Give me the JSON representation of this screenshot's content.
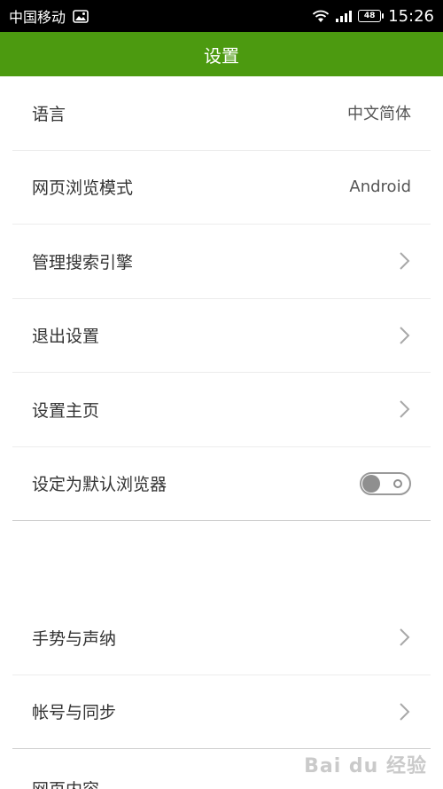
{
  "status_bar": {
    "carrier": "中国移动",
    "battery": "48",
    "time": "15:26"
  },
  "header": {
    "title": "设置"
  },
  "settings_group_1": [
    {
      "label": "语言",
      "value": "中文简体",
      "control": "value"
    },
    {
      "label": "网页浏览模式",
      "value": "Android",
      "control": "value"
    },
    {
      "label": "管理搜索引擎",
      "control": "chevron"
    },
    {
      "label": "退出设置",
      "control": "chevron"
    },
    {
      "label": "设置主页",
      "control": "chevron"
    },
    {
      "label": "设定为默认浏览器",
      "control": "toggle",
      "toggle_on": false
    }
  ],
  "settings_group_2": [
    {
      "label": "手势与声纳",
      "control": "chevron"
    },
    {
      "label": "帐号与同步",
      "control": "chevron"
    }
  ],
  "partial_item": {
    "label": "网页内容"
  },
  "watermark": {
    "text": "Bai du 经验"
  },
  "colors": {
    "header_green": "#4c9a10",
    "status_bar": "#000000"
  }
}
